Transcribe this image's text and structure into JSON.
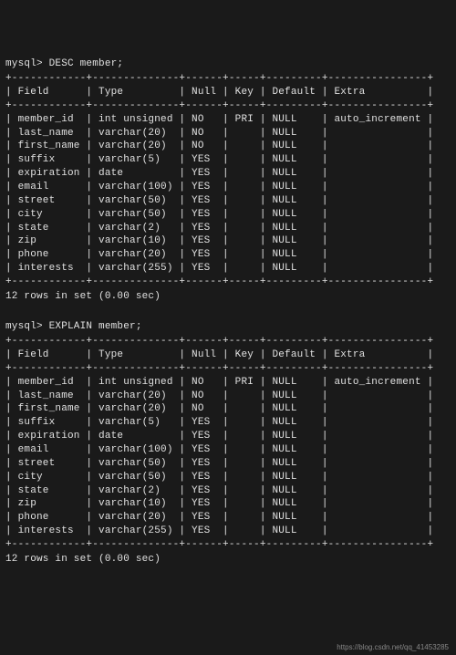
{
  "blocks": [
    {
      "prompt": "mysql> DESC member;",
      "sep": "+------------+--------------+------+-----+---------+----------------+",
      "header": "| Field      | Type         | Null | Key | Default | Extra          |",
      "rows": [
        "| member_id  | int unsigned | NO   | PRI | NULL    | auto_increment |",
        "| last_name  | varchar(20)  | NO   |     | NULL    |                |",
        "| first_name | varchar(20)  | NO   |     | NULL    |                |",
        "| suffix     | varchar(5)   | YES  |     | NULL    |                |",
        "| expiration | date         | YES  |     | NULL    |                |",
        "| email      | varchar(100) | YES  |     | NULL    |                |",
        "| street     | varchar(50)  | YES  |     | NULL    |                |",
        "| city       | varchar(50)  | YES  |     | NULL    |                |",
        "| state      | varchar(2)   | YES  |     | NULL    |                |",
        "| zip        | varchar(10)  | YES  |     | NULL    |                |",
        "| phone      | varchar(20)  | YES  |     | NULL    |                |",
        "| interests  | varchar(255) | YES  |     | NULL    |                |"
      ],
      "footer": "12 rows in set (0.00 sec)"
    },
    {
      "prompt": "mysql> EXPLAIN member;",
      "sep": "+------------+--------------+------+-----+---------+----------------+",
      "header": "| Field      | Type         | Null | Key | Default | Extra          |",
      "rows": [
        "| member_id  | int unsigned | NO   | PRI | NULL    | auto_increment |",
        "| last_name  | varchar(20)  | NO   |     | NULL    |                |",
        "| first_name | varchar(20)  | NO   |     | NULL    |                |",
        "| suffix     | varchar(5)   | YES  |     | NULL    |                |",
        "| expiration | date         | YES  |     | NULL    |                |",
        "| email      | varchar(100) | YES  |     | NULL    |                |",
        "| street     | varchar(50)  | YES  |     | NULL    |                |",
        "| city       | varchar(50)  | YES  |     | NULL    |                |",
        "| state      | varchar(2)   | YES  |     | NULL    |                |",
        "| zip        | varchar(10)  | YES  |     | NULL    |                |",
        "| phone      | varchar(20)  | YES  |     | NULL    |                |",
        "| interests  | varchar(255) | YES  |     | NULL    |                |"
      ],
      "footer": "12 rows in set (0.00 sec)"
    }
  ],
  "watermark": "https://blog.csdn.net/qq_41453285",
  "chart_data": {
    "type": "table",
    "title": "DESC member / EXPLAIN member",
    "columns": [
      "Field",
      "Type",
      "Null",
      "Key",
      "Default",
      "Extra"
    ],
    "rows": [
      [
        "member_id",
        "int unsigned",
        "NO",
        "PRI",
        "NULL",
        "auto_increment"
      ],
      [
        "last_name",
        "varchar(20)",
        "NO",
        "",
        "NULL",
        ""
      ],
      [
        "first_name",
        "varchar(20)",
        "NO",
        "",
        "NULL",
        ""
      ],
      [
        "suffix",
        "varchar(5)",
        "YES",
        "",
        "NULL",
        ""
      ],
      [
        "expiration",
        "date",
        "YES",
        "",
        "NULL",
        ""
      ],
      [
        "email",
        "varchar(100)",
        "YES",
        "",
        "NULL",
        ""
      ],
      [
        "street",
        "varchar(50)",
        "YES",
        "",
        "NULL",
        ""
      ],
      [
        "city",
        "varchar(50)",
        "YES",
        "",
        "NULL",
        ""
      ],
      [
        "state",
        "varchar(2)",
        "YES",
        "",
        "NULL",
        ""
      ],
      [
        "zip",
        "varchar(10)",
        "YES",
        "",
        "NULL",
        ""
      ],
      [
        "phone",
        "varchar(20)",
        "YES",
        "",
        "NULL",
        ""
      ],
      [
        "interests",
        "varchar(255)",
        "YES",
        "",
        "NULL",
        ""
      ]
    ]
  }
}
